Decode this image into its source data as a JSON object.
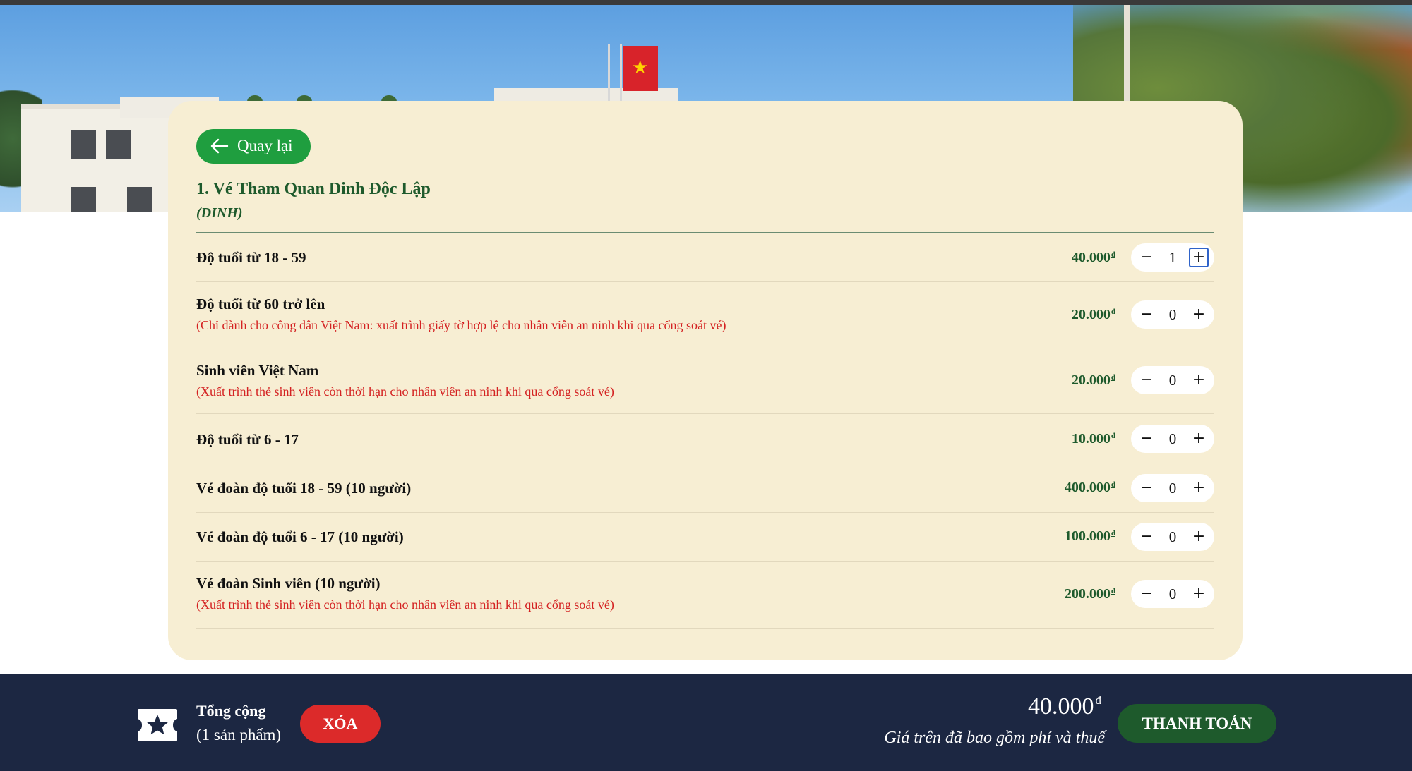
{
  "back_button": {
    "label": "Quay lại"
  },
  "ticket": {
    "title": "1. Vé Tham Quan Dinh Độc Lập",
    "code": "(DINH)"
  },
  "currency_symbol": "đ",
  "items": [
    {
      "name": "Độ tuổi từ 18 - 59",
      "note": "",
      "price": "40.000",
      "quantity": "1"
    },
    {
      "name": "Độ tuổi từ 60 trở lên",
      "note": "(Chỉ dành cho công dân Việt Nam: xuất trình giấy tờ hợp lệ cho nhân viên an ninh khi qua cổng soát vé)",
      "price": "20.000",
      "quantity": "0"
    },
    {
      "name": "Sinh viên Việt Nam",
      "note": "(Xuất trình thẻ sinh viên còn thời hạn cho nhân viên an ninh khi qua cổng soát vé)",
      "price": "20.000",
      "quantity": "0"
    },
    {
      "name": "Độ tuổi từ 6 - 17",
      "note": "",
      "price": "10.000",
      "quantity": "0"
    },
    {
      "name": "Vé đoàn độ tuổi 18 - 59 (10 người)",
      "note": "",
      "price": "400.000",
      "quantity": "0"
    },
    {
      "name": "Vé đoàn độ tuổi 6 - 17 (10 người)",
      "note": "",
      "price": "100.000",
      "quantity": "0"
    },
    {
      "name": "Vé đoàn Sinh viên (10 người)",
      "note": "(Xuất trình thẻ sinh viên còn thời hạn cho nhân viên an ninh khi qua cổng soát vé)",
      "price": "200.000",
      "quantity": "0"
    }
  ],
  "stepper": {
    "minus": "−",
    "plus": "+"
  },
  "footer": {
    "icon": "ticket-star-icon",
    "total_label": "Tổng cộng",
    "item_count": "(1 sản phẩm)",
    "clear_label": "XÓA",
    "total_amount": "40.000",
    "price_note": "Giá trên đã bao gồm phí và thuế",
    "checkout_label": "THANH TOÁN"
  },
  "colors": {
    "card_bg": "#f7eed3",
    "accent_green": "#1e5a2c",
    "back_button_green": "#1f9e3f",
    "note_red": "#d42222",
    "clear_red": "#dc2a2a",
    "footer_bg": "#1c2742"
  }
}
